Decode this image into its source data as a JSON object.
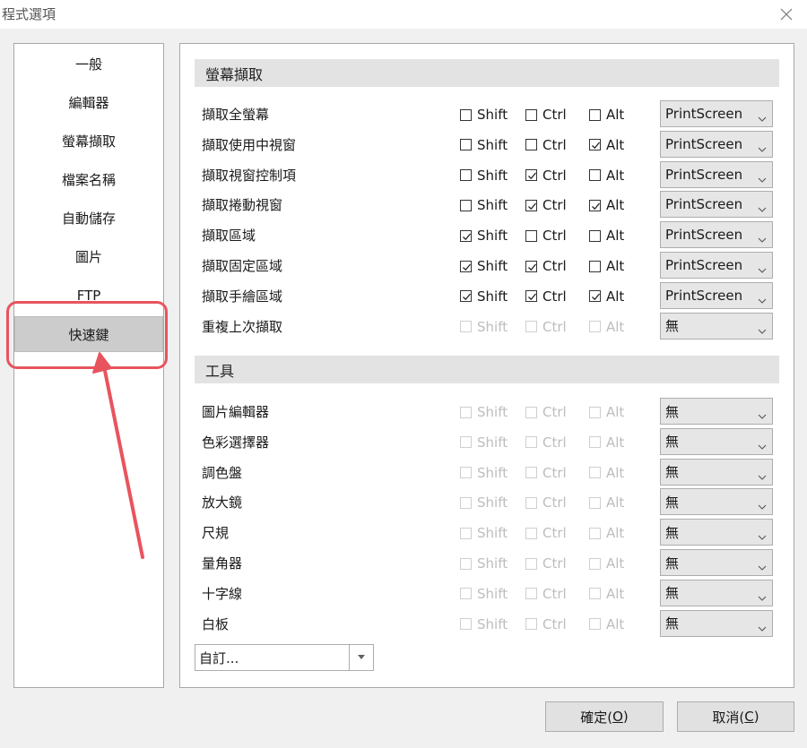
{
  "window": {
    "title": "程式選項"
  },
  "sidebar": {
    "items": [
      {
        "label": "一般"
      },
      {
        "label": "編輯器"
      },
      {
        "label": "螢幕擷取"
      },
      {
        "label": "檔案名稱"
      },
      {
        "label": "自動儲存"
      },
      {
        "label": "圖片"
      },
      {
        "label": "FTP"
      },
      {
        "label": "快速鍵",
        "selected": true
      }
    ]
  },
  "modifiers": {
    "shift": "Shift",
    "ctrl": "Ctrl",
    "alt": "Alt"
  },
  "capture": {
    "header": "螢幕擷取",
    "rows": [
      {
        "label": "擷取全螢幕",
        "shift": false,
        "ctrl": false,
        "alt": false,
        "key": "PrintScreen",
        "enabled": true
      },
      {
        "label": "擷取使用中視窗",
        "shift": false,
        "ctrl": false,
        "alt": true,
        "key": "PrintScreen",
        "enabled": true
      },
      {
        "label": "擷取視窗控制項",
        "shift": false,
        "ctrl": true,
        "alt": false,
        "key": "PrintScreen",
        "enabled": true
      },
      {
        "label": "擷取捲動視窗",
        "shift": false,
        "ctrl": true,
        "alt": true,
        "key": "PrintScreen",
        "enabled": true
      },
      {
        "label": "擷取區域",
        "shift": true,
        "ctrl": false,
        "alt": false,
        "key": "PrintScreen",
        "enabled": true
      },
      {
        "label": "擷取固定區域",
        "shift": true,
        "ctrl": true,
        "alt": false,
        "key": "PrintScreen",
        "enabled": true
      },
      {
        "label": "擷取手繪區域",
        "shift": true,
        "ctrl": true,
        "alt": true,
        "key": "PrintScreen",
        "enabled": true
      },
      {
        "label": "重複上次擷取",
        "shift": false,
        "ctrl": false,
        "alt": false,
        "key": "無",
        "enabled": false
      }
    ]
  },
  "tools": {
    "header": "工具",
    "rows": [
      {
        "label": "圖片編輯器",
        "shift": false,
        "ctrl": false,
        "alt": false,
        "key": "無",
        "enabled": false
      },
      {
        "label": "色彩選擇器",
        "shift": false,
        "ctrl": false,
        "alt": false,
        "key": "無",
        "enabled": false
      },
      {
        "label": "調色盤",
        "shift": false,
        "ctrl": false,
        "alt": false,
        "key": "無",
        "enabled": false
      },
      {
        "label": "放大鏡",
        "shift": false,
        "ctrl": false,
        "alt": false,
        "key": "無",
        "enabled": false
      },
      {
        "label": "尺規",
        "shift": false,
        "ctrl": false,
        "alt": false,
        "key": "無",
        "enabled": false
      },
      {
        "label": "量角器",
        "shift": false,
        "ctrl": false,
        "alt": false,
        "key": "無",
        "enabled": false
      },
      {
        "label": "十字線",
        "shift": false,
        "ctrl": false,
        "alt": false,
        "key": "無",
        "enabled": false
      },
      {
        "label": "白板",
        "shift": false,
        "ctrl": false,
        "alt": false,
        "key": "無",
        "enabled": false
      }
    ]
  },
  "custom": {
    "value": "自訂..."
  },
  "buttons": {
    "ok_label": "確定(",
    "ok_key": "O",
    "ok_end": ")",
    "cancel_label": "取消(",
    "cancel_key": "C",
    "cancel_end": ")"
  },
  "colors": {
    "highlight": "#e8545e",
    "section_header_bg": "#e3e3e3",
    "selected_nav_bg": "#cccccc",
    "disabled_text": "#bdbdbd"
  }
}
